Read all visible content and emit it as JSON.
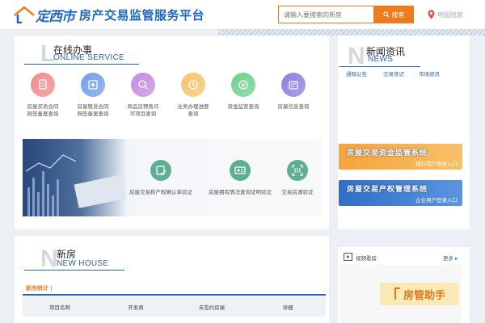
{
  "header": {
    "logo_city": "定西市",
    "logo_title": "房产交易监管服务平台",
    "search": {
      "placeholder": "请输入要搜索的新房",
      "button_label": "搜索"
    },
    "map_label": "地图找房"
  },
  "online_service": {
    "letter": "L",
    "title": "在线办事",
    "subtitle": "ONLINE SERVICE",
    "items": [
      {
        "label": "房屋买卖合同\n网签备案查询",
        "icon": "contract-icon",
        "color": "#f08b8b"
      },
      {
        "label": "房屋租赁合同\n网签备案查询",
        "icon": "lease-icon",
        "color": "#6f9fe8"
      },
      {
        "label": "商品房预售许\n可项目查询",
        "icon": "permit-icon",
        "color": "#c48be0"
      },
      {
        "label": "业务办理进度\n查询",
        "icon": "progress-icon",
        "color": "#f5c46f"
      },
      {
        "label": "资金监管查询",
        "icon": "fund-icon",
        "color": "#6fcf8f"
      },
      {
        "label": "房屋信息查询",
        "icon": "house-info-icon",
        "color": "#8b7fe0"
      }
    ],
    "banner_items": [
      {
        "label": "房屋交易和产权确认单验证",
        "icon": "verify-icon"
      },
      {
        "label": "房屋拥有情况查询证明验证",
        "icon": "id-card-icon"
      },
      {
        "label": "交易房源验证",
        "icon": "scan-icon"
      }
    ]
  },
  "news": {
    "letter": "N",
    "title": "新闻资讯",
    "subtitle": "NEWS",
    "tabs": [
      "通知公告",
      "交易常识",
      "市场资讯"
    ],
    "ads": [
      {
        "title": "房屋交易资金监管系统",
        "sub": "银行用户登录入口",
        "colors": [
          "#f6a33a",
          "#f7c06b"
        ]
      },
      {
        "title": "房屋交易产权管理系统",
        "sub": "企业用户登录入口",
        "colors": [
          "#2f6fc8",
          "#5a95e0"
        ]
      }
    ]
  },
  "new_house": {
    "letter": "N",
    "title": "新房",
    "subtitle": "NEW HOUSE",
    "stats_label": "新房统计",
    "columns": [
      "项目名称",
      "开发商",
      "未签约房屋",
      "详细"
    ]
  },
  "video": {
    "label": "视频看房",
    "more": "更多",
    "assistant": "房管助手"
  }
}
